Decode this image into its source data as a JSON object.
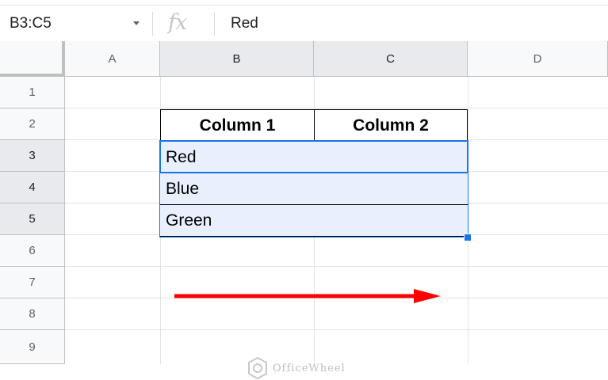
{
  "formula_bar": {
    "name_box": "B3:C5",
    "fx_symbol": "fx",
    "formula_value": "Red"
  },
  "columns": [
    "A",
    "B",
    "C",
    "D"
  ],
  "rows": [
    "1",
    "2",
    "3",
    "4",
    "5",
    "6",
    "7",
    "8",
    "9"
  ],
  "table": {
    "headers": [
      "Column 1",
      "Column 2"
    ],
    "values": [
      "Red",
      "Blue",
      "Green"
    ]
  },
  "watermark": "OfficeWheel",
  "colors": {
    "selection_border": "#1a73e8",
    "selection_fill": "#e8f0fe",
    "arrow": "#ff0000"
  },
  "icons": [
    "dropdown-caret-icon",
    "fx-icon",
    "officewheel-logo-icon",
    "red-arrow-icon"
  ]
}
